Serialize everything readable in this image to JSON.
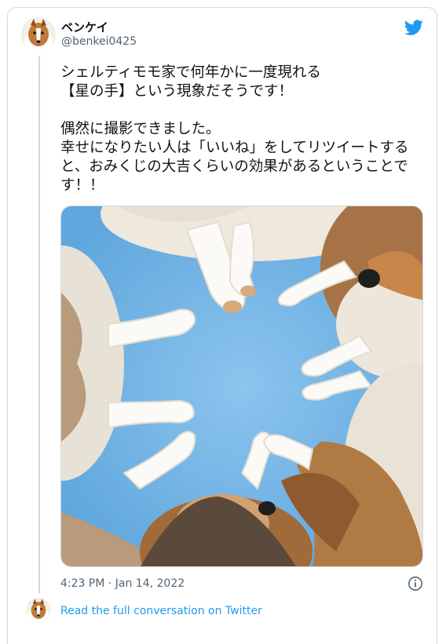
{
  "author": {
    "name": "ベンケイ",
    "handle": "@benkei0425"
  },
  "tweet": {
    "text": "シェルティモモ家で何年かに一度現れる\n【星の手】という現象だそうです！\n\n偶然に撮影できました。\n幸せになりたい人は「いいね」をしてリツイートすると、おみくじの大吉くらいの効果があるということです！！",
    "timestamp": "4:23 PM · Jan 14, 2022",
    "photo_alt": ""
  },
  "footer": {
    "read_more": "Read the full conversation on Twitter"
  },
  "icons": {
    "logo": "twitter-bird-icon",
    "info": "info-icon"
  },
  "colors": {
    "accent": "#1d9bf0",
    "text": "#0f1419",
    "muted": "#536471",
    "border": "#cfd9de",
    "photo_bg": "#6fb2e3"
  }
}
